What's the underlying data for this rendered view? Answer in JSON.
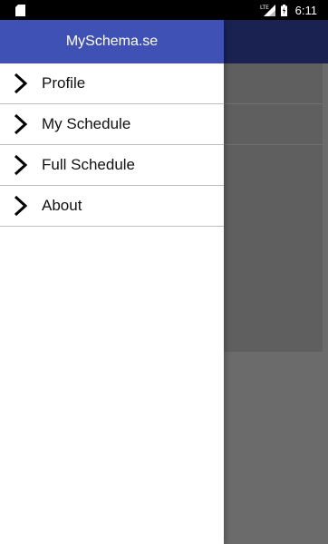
{
  "status_bar": {
    "time": "6:11",
    "network_type": "LTE",
    "icons": [
      "sd-card-icon",
      "lte-signal-icon",
      "battery-icon"
    ]
  },
  "drawer": {
    "title": "MySchema.se",
    "header_color": "#3f51b5",
    "items": [
      {
        "label": "Profile",
        "icon": "chevron-right-icon"
      },
      {
        "label": "My Schedule",
        "icon": "chevron-right-icon"
      },
      {
        "label": "Full Schedule",
        "icon": "chevron-right-icon"
      },
      {
        "label": "About",
        "icon": "chevron-right-icon"
      }
    ]
  },
  "background_app": {
    "toolbar_color": "#1a2252"
  }
}
